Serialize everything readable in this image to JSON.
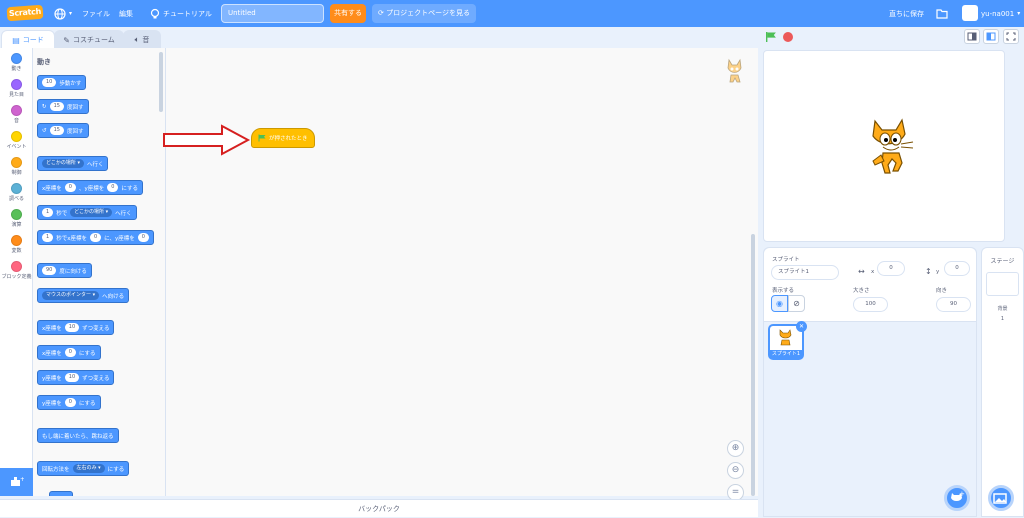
{
  "menubar": {
    "logo_text": "Scratch",
    "file": "ファイル",
    "edit": "編集",
    "tutorial": "チュートリアル",
    "project_title": "Untitled",
    "share": "共有する",
    "project_page": "プロジェクトページを見る",
    "save_now": "直ちに保存",
    "username": "yu-na001"
  },
  "tabs": {
    "code": "コード",
    "costumes": "コスチューム"
  },
  "categories": [
    {
      "label": "動き",
      "color": "#4c97ff"
    },
    {
      "label": "見た目",
      "color": "#9966ff"
    },
    {
      "label": "音",
      "color": "#cf63cf"
    },
    {
      "label": "イベント",
      "color": "#ffd500"
    },
    {
      "label": "制御",
      "color": "#ffab19"
    },
    {
      "label": "調べる",
      "color": "#5cb1d6"
    },
    {
      "label": "演算",
      "color": "#59c059"
    },
    {
      "label": "変数",
      "color": "#ff8c1a"
    },
    {
      "label": "ブロック定義",
      "color": "#ff6680"
    }
  ],
  "palette": {
    "heading": "動き",
    "move": {
      "value": "10",
      "text": "歩動かす"
    },
    "turn_right": {
      "value": "15",
      "text": "度回す"
    },
    "turn_left": {
      "value": "15",
      "text": "度回す"
    },
    "goto": {
      "dropdown": "どこかの場所",
      "text": "へ行く"
    },
    "gotoxy": {
      "t1": "x座標を",
      "v1": "0",
      "t2": "、y座標を",
      "v2": "0",
      "t3": "にする"
    },
    "glide": {
      "v1": "1",
      "t1": "秒で",
      "dropdown": "どこかの場所",
      "t2": "へ行く"
    },
    "glidexy": {
      "v1": "1",
      "t1": "秒でx座標を",
      "v2": "0",
      "t2": "に、y座標を",
      "v3": "0"
    },
    "point_dir": {
      "value": "90",
      "text": "度に向ける"
    },
    "point_towards": {
      "dropdown": "マウスのポインター",
      "text": "へ向ける"
    },
    "change_x": {
      "t1": "x座標を",
      "value": "10",
      "t2": "ずつ変える"
    },
    "set_x": {
      "t1": "x座標を",
      "value": "0",
      "t2": "にする"
    },
    "change_y": {
      "t1": "y座標を",
      "value": "10",
      "t2": "ずつ変える"
    },
    "set_y": {
      "t1": "y座標を",
      "value": "0",
      "t2": "にする"
    },
    "bounce": "もし端に着いたら、跳ね返る",
    "rotation_style": {
      "t1": "回転方法を",
      "dropdown": "左右のみ",
      "t2": "にする"
    }
  },
  "script": {
    "hat_block": "が押されたとき"
  },
  "backpack": "バックパック",
  "sprite_info": {
    "sprite_label": "スプライト",
    "sprite_name": "スプライト1",
    "x_label": "x",
    "x_value": "0",
    "y_label": "y",
    "y_value": "0",
    "show_label": "表示する",
    "size_label": "大きさ",
    "size_value": "100",
    "direction_label": "向き",
    "direction_value": "90"
  },
  "sprite_list": [
    {
      "name": "スプライト1"
    }
  ],
  "stage_pane": {
    "title": "ステージ",
    "backdrops_label": "背景",
    "backdrops_count": "1"
  },
  "colors": {
    "brand_blue": "#4c97ff",
    "share_orange": "#ff8c1a",
    "events_yellow": "#ffbf00"
  }
}
